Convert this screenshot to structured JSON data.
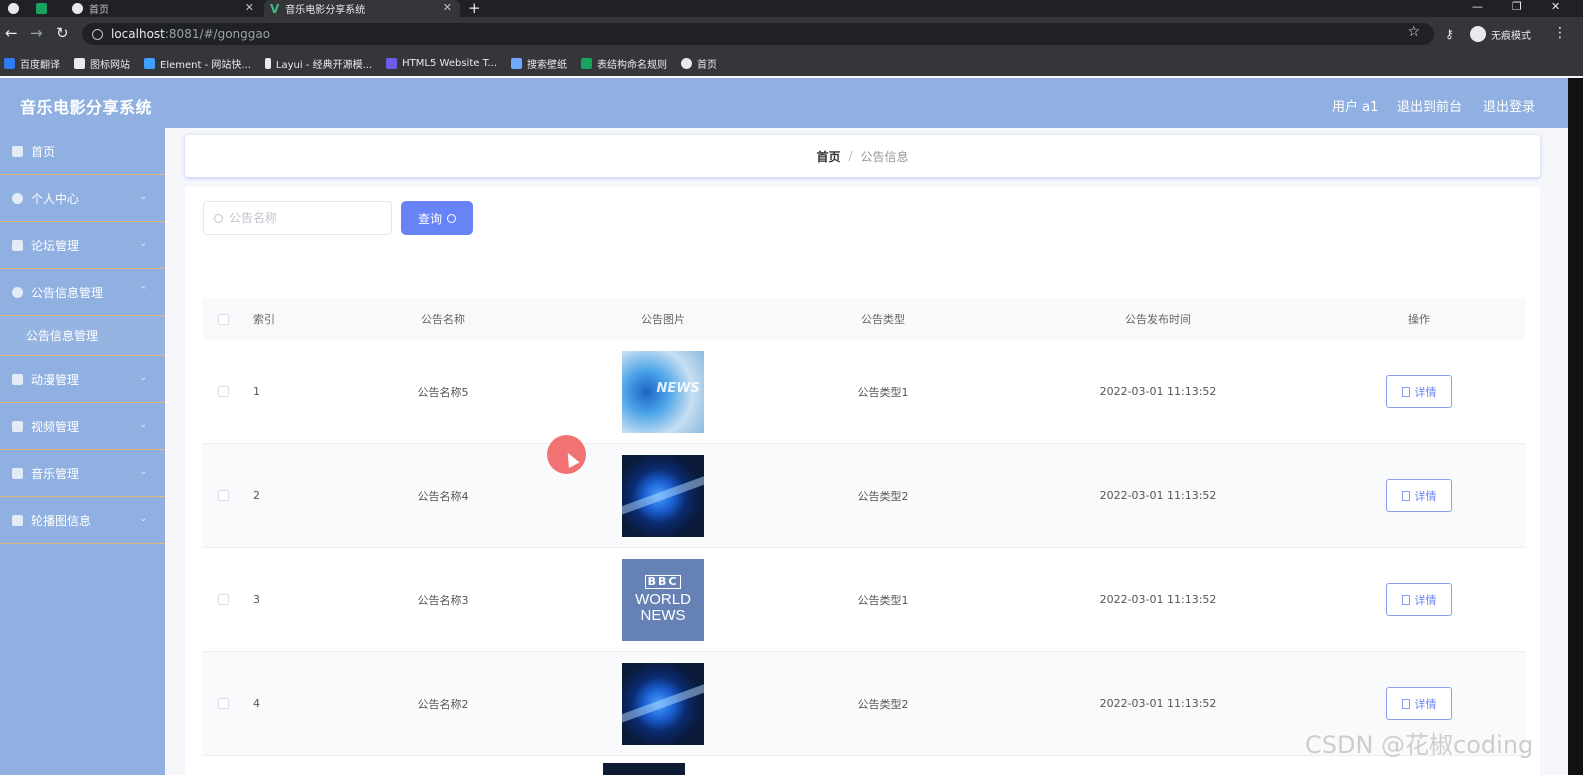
{
  "browser": {
    "tabs": [
      {
        "label": ""
      },
      {
        "label": "首页"
      },
      {
        "label": "音乐电影分享系统"
      }
    ],
    "url_host": "localhost",
    "url_path": ":8081/#/gonggao",
    "incognito_label": "无痕模式",
    "bookmarks": [
      {
        "label": "百度翻译",
        "color": "#2f7bf5"
      },
      {
        "label": "图标网站",
        "color": "#e8eaed"
      },
      {
        "label": "Element - 网站快...",
        "color": "#409eff"
      },
      {
        "label": "Layui - 经典开源模...",
        "color": "#e8eaed"
      },
      {
        "label": "HTML5 Website T...",
        "color": "#6c5ce7"
      },
      {
        "label": "搜索壁纸",
        "color": "#6fa8ff"
      },
      {
        "label": "表结构命名规则",
        "color": "#1aa260"
      },
      {
        "label": "首页",
        "color": "#e8eaed"
      }
    ]
  },
  "header": {
    "title": "音乐电影分享系统",
    "user": "用户 a1",
    "back_to_front": "退出到前台",
    "logout": "退出登录"
  },
  "sidebar": {
    "items": [
      {
        "label": "首页"
      },
      {
        "label": "个人中心"
      },
      {
        "label": "论坛管理"
      },
      {
        "label": "公告信息管理"
      },
      {
        "label": "公告信息管理"
      },
      {
        "label": "动漫管理"
      },
      {
        "label": "视频管理"
      },
      {
        "label": "音乐管理"
      },
      {
        "label": "轮播图信息"
      }
    ]
  },
  "breadcrumb": {
    "home": "首页",
    "separator": "/",
    "current": "公告信息"
  },
  "search": {
    "placeholder": "公告名称",
    "value": "",
    "button_label": "查询"
  },
  "table": {
    "headers": {
      "index": "索引",
      "name": "公告名称",
      "image": "公告图片",
      "type": "公告类型",
      "time": "公告发布时间",
      "op": "操作"
    },
    "rows": [
      {
        "index": "1",
        "name": "公告名称5",
        "image": "news-thumbnail",
        "type": "公告类型1",
        "time": "2022-03-01 11:13:52",
        "action": "详情"
      },
      {
        "index": "2",
        "name": "公告名称4",
        "image": "globe-thumbnail",
        "type": "公告类型2",
        "time": "2022-03-01 11:13:52",
        "action": "详情"
      },
      {
        "index": "3",
        "name": "公告名称3",
        "image": "bbc-world-news-thumbnail",
        "type": "公告类型1",
        "time": "2022-03-01 11:13:52",
        "action": "详情"
      },
      {
        "index": "4",
        "name": "公告名称2",
        "image": "globe-thumbnail",
        "type": "公告类型2",
        "time": "2022-03-01 11:13:52",
        "action": "详情"
      }
    ]
  },
  "thumbs": {
    "news_word": "NEWS",
    "bbc_logo": "BBC",
    "bbc_line1": "WORLD",
    "bbc_line2": "NEWS"
  },
  "watermark": "CSDN @花椒coding",
  "colors": {
    "header_bg": "#8fb0e0",
    "accent": "#6883f5",
    "divider": "#e3b47c"
  }
}
